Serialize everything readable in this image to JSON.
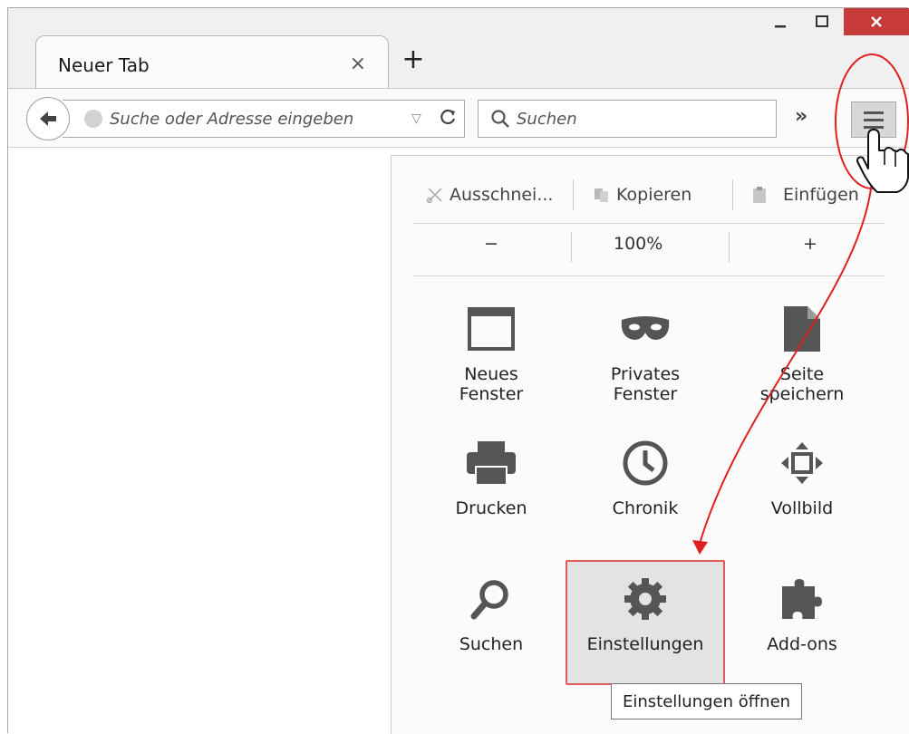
{
  "window": {
    "tab_title": "Neuer Tab",
    "tab_close": "×",
    "new_tab": "+",
    "minimize": "_",
    "maximize": "☐",
    "close": "✕"
  },
  "navbar": {
    "url_placeholder": "Suche oder Adresse eingeben",
    "search_placeholder": "Suchen",
    "overflow": "»"
  },
  "menu": {
    "edit": {
      "cut": "Ausschnei...",
      "copy": "Kopieren",
      "paste": "Einfügen"
    },
    "zoom": {
      "out": "−",
      "level": "100%",
      "in": "+"
    },
    "items": [
      {
        "label": "Neues\nFenster",
        "icon": "window-icon"
      },
      {
        "label": "Privates\nFenster",
        "icon": "mask-icon"
      },
      {
        "label": "Seite\nspeichern",
        "icon": "page-icon"
      },
      {
        "label": "Drucken",
        "icon": "printer-icon"
      },
      {
        "label": "Chronik",
        "icon": "clock-icon"
      },
      {
        "label": "Vollbild",
        "icon": "fullscreen-icon"
      },
      {
        "label": "Suchen",
        "icon": "search-icon"
      },
      {
        "label": "Einstellungen",
        "icon": "gear-icon"
      },
      {
        "label": "Add-ons",
        "icon": "puzzle-icon"
      }
    ],
    "tooltip": "Einstellungen öffnen"
  },
  "colors": {
    "annotation": "#e02020",
    "close_button": "#c73a3a",
    "icon_gray": "#555555"
  }
}
